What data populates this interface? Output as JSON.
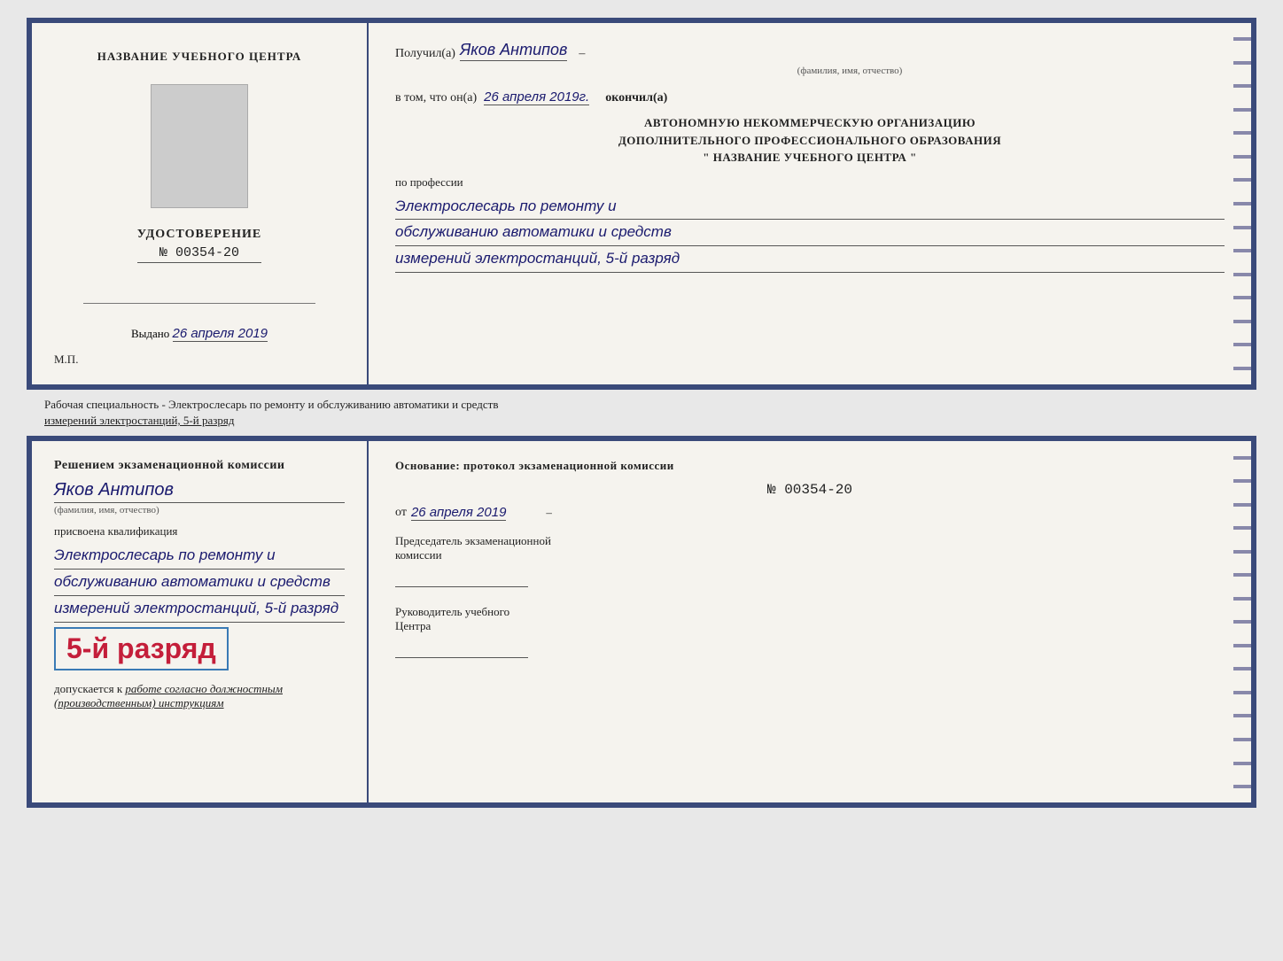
{
  "top_left": {
    "org_name": "НАЗВАНИЕ УЧЕБНОГО ЦЕНТРА",
    "udostoverenie_label": "УДОСТОВЕРЕНИЕ",
    "number": "№ 00354-20",
    "vydano_label": "Выдано",
    "vydano_date": "26 апреля 2019",
    "mp_label": "М.П."
  },
  "top_right": {
    "poluchil_label": "Получил(а)",
    "recipient_name": "Яков Антипов",
    "fio_label": "(фамилия, имя, отчество)",
    "vtom_label": "в том, что он(а)",
    "date_completed": "26 апреля 2019г.",
    "okonchill_label": "окончил(а)",
    "org_line1": "АВТОНОМНУЮ НЕКОММЕРЧЕСКУЮ ОРГАНИЗАЦИЮ",
    "org_line2": "ДОПОЛНИТЕЛЬНОГО ПРОФЕССИОНАЛЬНОГО ОБРАЗОВАНИЯ",
    "org_line3": "\"    НАЗВАНИЕ УЧЕБНОГО ЦЕНТРА    \"",
    "po_professii": "по профессии",
    "profession_line1": "Электрослесарь по ремонту и",
    "profession_line2": "обслуживанию автоматики и средств",
    "profession_line3": "измерений электростанций, 5-й разряд"
  },
  "between_text": {
    "line1": "Рабочая специальность - Электрослесарь по ремонту и обслуживанию автоматики и средств",
    "line2": "измерений электростанций, 5-й разряд"
  },
  "bottom_left": {
    "resheniem_label": "Решением экзаменационной комиссии",
    "name": "Яков Антипов",
    "fio_label": "(фамилия, имя, отчество)",
    "prisvoena_label": "присвоена квалификация",
    "qual_line1": "Электрослесарь по ремонту и",
    "qual_line2": "обслуживанию автоматики и средств",
    "qual_line3": "измерений электростанций, 5-й разряд",
    "razryad_big": "5-й разряд",
    "dopuskaetsya": "допускается к",
    "dopuskaetsya_italic": "работе согласно должностным (производственным) инструкциям"
  },
  "bottom_right": {
    "osnovanie_label": "Основание: протокол экзаменационной комиссии",
    "number": "№  00354-20",
    "ot_label": "от",
    "ot_date": "26 апреля 2019",
    "predsedatel_line1": "Председатель экзаменационной",
    "predsedatel_line2": "комиссии",
    "rukovoditel_line1": "Руководитель учебного",
    "rukovoditel_line2": "Центра"
  },
  "colors": {
    "border": "#3a4a7a",
    "handwritten": "#1a1a6e",
    "text": "#222222",
    "highlight_red": "#c41e3a",
    "highlight_border": "#3a7ab5"
  }
}
